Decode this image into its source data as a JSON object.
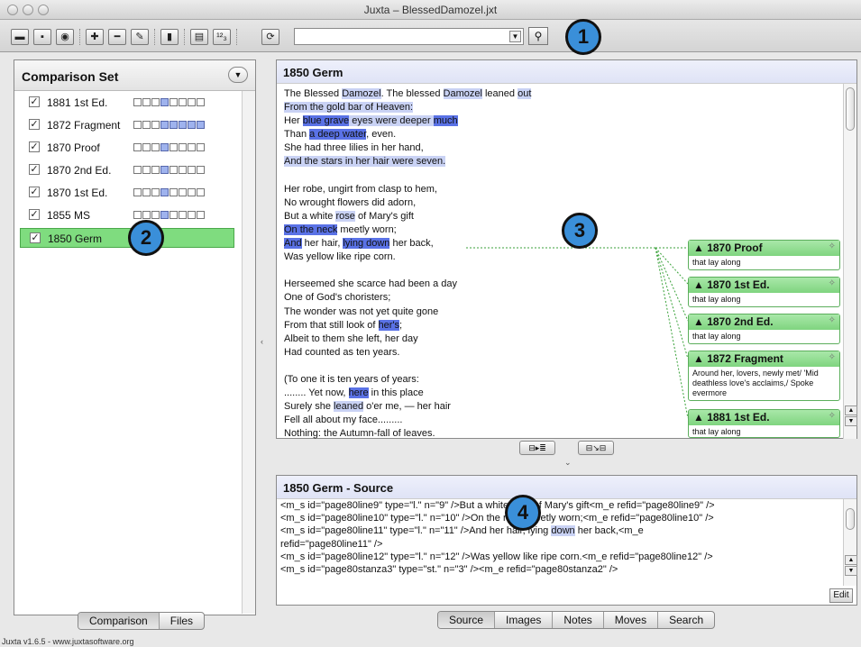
{
  "window": {
    "title": "Juxta – BlessedDamozel.jxt"
  },
  "toolbar": {
    "buttons": [
      "open-icon",
      "save-icon",
      "export-icon",
      "add-icon",
      "remove-icon",
      "edit-icon",
      "chart-icon",
      "table-icon",
      "numbering-icon",
      "refresh-icon"
    ],
    "search_value": "",
    "callout_1": "1"
  },
  "comparison_set": {
    "title": "Comparison Set",
    "callout_2": "2",
    "witnesses": [
      {
        "label": "1881 1st Ed.",
        "checked": true,
        "boxes": [
          0,
          0,
          0,
          1,
          0,
          0,
          0,
          0
        ]
      },
      {
        "label": "1872 Fragment",
        "checked": true,
        "boxes": [
          0,
          0,
          0,
          1,
          1,
          1,
          1,
          1
        ]
      },
      {
        "label": "1870 Proof",
        "checked": true,
        "boxes": [
          0,
          0,
          0,
          1,
          0,
          0,
          0,
          0
        ]
      },
      {
        "label": "1870 2nd Ed.",
        "checked": true,
        "boxes": [
          0,
          0,
          0,
          1,
          0,
          0,
          0,
          0
        ]
      },
      {
        "label": "1870 1st Ed.",
        "checked": true,
        "boxes": [
          0,
          0,
          0,
          1,
          0,
          0,
          0,
          0
        ]
      },
      {
        "label": "1855 MS",
        "checked": true,
        "boxes": [
          0,
          0,
          0,
          1,
          0,
          0,
          0,
          0
        ]
      },
      {
        "label": "1850 Germ",
        "checked": true,
        "selected": true
      }
    ],
    "tabs": [
      "Comparison",
      "Files"
    ],
    "active_tab": "Comparison"
  },
  "document": {
    "title": "1850 Germ",
    "callout_3": "3",
    "lines": [
      [
        [
          "The Blessed ",
          ""
        ],
        [
          "Damozel",
          "hl"
        ],
        [
          ". The blessed ",
          ""
        ],
        [
          "Damozel",
          "hl"
        ],
        [
          " leaned ",
          ""
        ],
        [
          "out",
          "hl"
        ]
      ],
      [
        [
          "From the gold bar of Heaven:",
          "hl"
        ]
      ],
      [
        [
          "Her ",
          ""
        ],
        [
          "blue grave",
          "hd"
        ],
        [
          " eyes were deeper ",
          "hl"
        ],
        [
          "much",
          "hd"
        ]
      ],
      [
        [
          "Than ",
          ""
        ],
        [
          "a deep water",
          "hd"
        ],
        [
          ", even.",
          ""
        ]
      ],
      [
        [
          "She had three lilies in her hand,",
          ""
        ]
      ],
      [
        [
          "And the stars in her hair were seven.",
          "hl"
        ]
      ],
      [
        [
          "",
          ""
        ]
      ],
      [
        [
          "Her robe, ungirt from clasp to hem,",
          ""
        ]
      ],
      [
        [
          "No wrought flowers did adorn,",
          ""
        ]
      ],
      [
        [
          "But a white ",
          ""
        ],
        [
          "rose",
          "hl"
        ],
        [
          " of Mary's gift",
          ""
        ]
      ],
      [
        [
          "On the neck",
          "hd"
        ],
        [
          " meetly worn;",
          ""
        ]
      ],
      [
        [
          "And",
          "hd"
        ],
        [
          " her hair, ",
          ""
        ],
        [
          "lying down",
          "hd"
        ],
        [
          " her back,",
          ""
        ]
      ],
      [
        [
          "Was yellow like ripe corn.",
          ""
        ]
      ],
      [
        [
          "",
          ""
        ]
      ],
      [
        [
          "Herseemed she scarce had been a day",
          ""
        ]
      ],
      [
        [
          "One of God's choristers;",
          ""
        ]
      ],
      [
        [
          "The wonder was not yet quite gone",
          ""
        ]
      ],
      [
        [
          "From that still look of ",
          ""
        ],
        [
          "her's",
          "hd"
        ],
        [
          ";",
          ""
        ]
      ],
      [
        [
          "Albeit to them she left, her day",
          ""
        ]
      ],
      [
        [
          "Had counted as ten years.",
          ""
        ]
      ],
      [
        [
          "",
          ""
        ]
      ],
      [
        [
          "(To one it is ten years of years:",
          ""
        ]
      ],
      [
        [
          "........ Yet now, ",
          ""
        ],
        [
          "here",
          "hd"
        ],
        [
          " in this place",
          ""
        ]
      ],
      [
        [
          "Surely she ",
          ""
        ],
        [
          "leaned",
          "hl"
        ],
        [
          " o'er me, — her hair",
          ""
        ]
      ],
      [
        [
          "Fell all about my face.........",
          ""
        ]
      ],
      [
        [
          "Nothing: the Autumn-fall of leaves.",
          ""
        ]
      ]
    ],
    "notes": [
      {
        "title": "▲ 1870 Proof",
        "body": "that lay along"
      },
      {
        "title": "▲ 1870 1st Ed.",
        "body": "that lay along"
      },
      {
        "title": "▲ 1870 2nd Ed.",
        "body": "that lay along"
      },
      {
        "title": "▲ 1872 Fragment",
        "body": "Around her, lovers, newly met/ 'Mid deathless love's acclaims,/ Spoke evermore"
      },
      {
        "title": "▲ 1881 1st Ed.",
        "body": "that lay along"
      }
    ]
  },
  "source": {
    "title": "1850 Germ - Source",
    "callout_4": "4",
    "lines": [
      "<m_s id=\"page80line9\" type=\"l.\" n=\"9\" />But a white rose of Mary's gift<m_e refid=\"page80line9\" />",
      "<m_s id=\"page80line10\" type=\"l.\" n=\"10\" />On the neck meetly worn;<m_e refid=\"page80line10\" />",
      "<m_s id=\"page80line11\" type=\"l.\" n=\"11\" />And her hair, lying down her back,<m_e",
      "refid=\"page80line11\" />",
      "<m_s id=\"page80line12\" type=\"l.\" n=\"12\" />Was yellow like ripe corn.<m_e refid=\"page80line12\" />",
      "<m_s id=\"page80stanza3\" type=\"st.\" n=\"3\" /><m_e refid=\"page80stanza2\" />"
    ],
    "edit_label": "Edit",
    "tabs": [
      "Source",
      "Images",
      "Notes",
      "Moves",
      "Search"
    ],
    "active_tab": "Source"
  },
  "status": {
    "text": "Juxta v1.6.5 - www.juxtasoftware.org"
  },
  "colors": {
    "highlight_light": "#c9d2f4",
    "highlight_dark": "#5a72e6",
    "note_green": "#7fd47f",
    "callout_blue": "#3a8fd9",
    "selected_row": "#7fdc7f"
  }
}
